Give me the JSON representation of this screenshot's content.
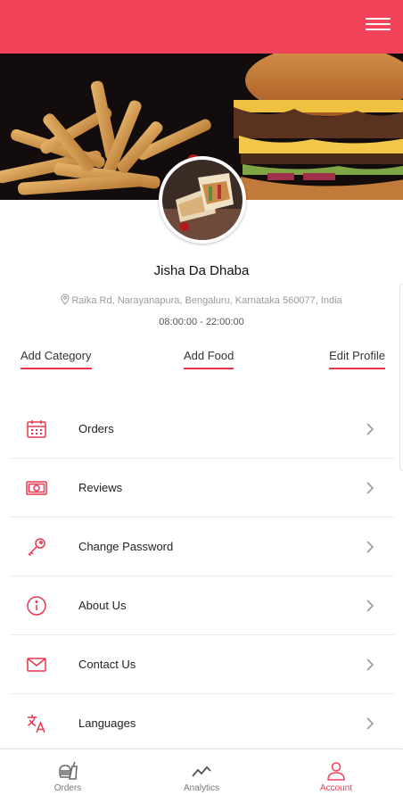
{
  "header": {
    "menu_icon": "hamburger-menu-icon",
    "color": "#f0435a"
  },
  "restaurant": {
    "name": "Jisha Da Dhaba",
    "address": "Raika Rd, Narayanapura, Bengaluru, Karnataka 560077, India",
    "hours": "08:00:00 - 22:00:00"
  },
  "actions": {
    "add_category": "Add Category",
    "add_food": "Add Food",
    "edit_profile": "Edit Profile"
  },
  "menu": [
    {
      "label": "Orders",
      "icon": "calendar-icon"
    },
    {
      "label": "Reviews",
      "icon": "money-icon"
    },
    {
      "label": "Change Password",
      "icon": "key-icon"
    },
    {
      "label": "About Us",
      "icon": "info-icon"
    },
    {
      "label": "Contact Us",
      "icon": "mail-icon"
    },
    {
      "label": "Languages",
      "icon": "translate-icon"
    }
  ],
  "bottom_nav": {
    "orders": "Orders",
    "analytics": "Analytics",
    "account": "Account",
    "active": "Account"
  }
}
